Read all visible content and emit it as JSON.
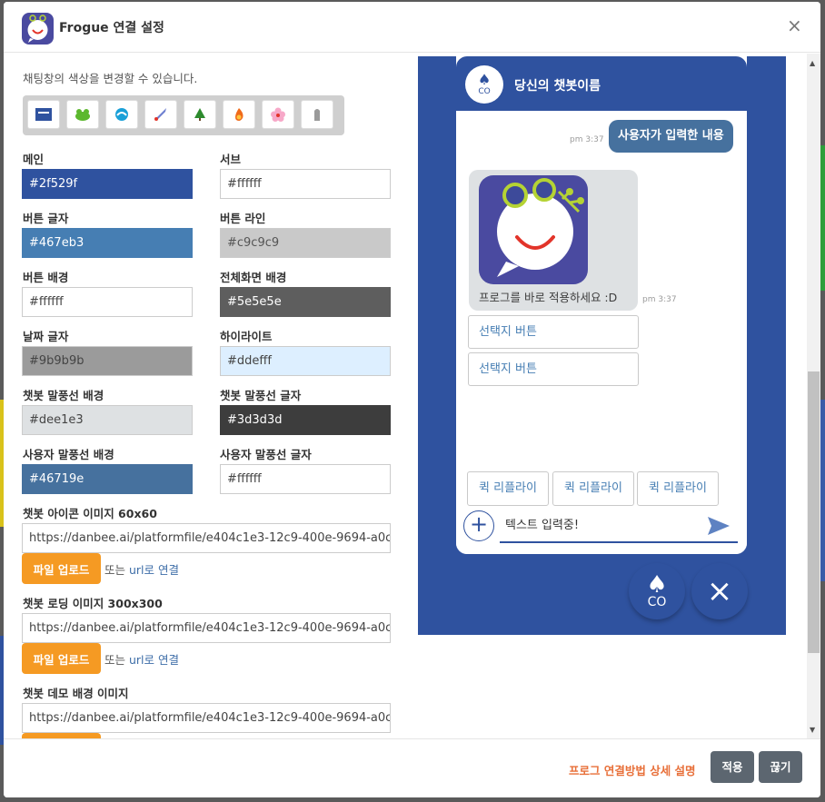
{
  "modal": {
    "title": "Frogue 연결 설정",
    "close_icon": "×"
  },
  "left": {
    "description": "채팅창의 색상을 변경할 수 있습니다.",
    "palette_icons": [
      "back-theme-icon",
      "frog-icon",
      "wave-icon",
      "rocket-icon",
      "tree-icon",
      "fire-icon",
      "flower-icon",
      "stone-icon"
    ],
    "fields": [
      {
        "label": "메인",
        "value": "#2f529f",
        "bg": "#2f529f",
        "fg": "#ffffff"
      },
      {
        "label": "서브",
        "value": "#ffffff",
        "bg": "#ffffff",
        "fg": "#444444"
      },
      {
        "label": "버튼 글자",
        "value": "#467eb3",
        "bg": "#467eb3",
        "fg": "#ffffff"
      },
      {
        "label": "버튼 라인",
        "value": "#c9c9c9",
        "bg": "#c9c9c9",
        "fg": "#555555"
      },
      {
        "label": "버튼 배경",
        "value": "#ffffff",
        "bg": "#ffffff",
        "fg": "#444444"
      },
      {
        "label": "전체화면 배경",
        "value": "#5e5e5e",
        "bg": "#5e5e5e",
        "fg": "#ffffff"
      },
      {
        "label": "날짜 글자",
        "value": "#9b9b9b",
        "bg": "#9b9b9b",
        "fg": "#444444"
      },
      {
        "label": "하이라이트",
        "value": "#ddefff",
        "bg": "#ddefff",
        "fg": "#444444"
      },
      {
        "label": "챗봇 말풍선 배경",
        "value": "#dee1e3",
        "bg": "#dee1e3",
        "fg": "#444444"
      },
      {
        "label": "챗봇 말풍선 글자",
        "value": "#3d3d3d",
        "bg": "#3d3d3d",
        "fg": "#ffffff"
      },
      {
        "label": "사용자 말풍선 배경",
        "value": "#46719e",
        "bg": "#46719e",
        "fg": "#ffffff"
      },
      {
        "label": "사용자 말풍선 글자",
        "value": "#ffffff",
        "bg": "#ffffff",
        "fg": "#444444"
      }
    ],
    "icon_image": {
      "label": "챗봇 아이콘 이미지 60x60",
      "url": "https://danbee.ai/platformfile/e404c1e3-12c9-400e-9694-a0c",
      "upload": "파일 업로드",
      "or": "또는 ",
      "link": "url로 연결"
    },
    "loading_image": {
      "label": "챗봇 로딩 이미지 300x300",
      "url": "https://danbee.ai/platformfile/e404c1e3-12c9-400e-9694-a0c",
      "upload": "파일 업로드",
      "or": "또는 ",
      "link": "url로 연결"
    },
    "demo_bg_image": {
      "label": "챗봇 데모 배경 이미지",
      "url": "https://danbee.ai/platformfile/e404c1e3-12c9-400e-9694-a0c"
    }
  },
  "preview": {
    "bot_name": "당신의 챗봇이름",
    "avatar_text": "CO",
    "user_message": "사용자가 입력한 내용",
    "user_time": "pm 3:37",
    "bot_message": "프로그를 바로 적용하세요 :D",
    "bot_time": "pm 3:37",
    "choices": [
      "선택지 버튼",
      "선택지 버튼"
    ],
    "quick_replies": [
      "퀵 리플라이",
      "퀵 리플라이",
      "퀵 리플라이"
    ],
    "input_placeholder": "텍스트 입력중!",
    "fab_text": "CO"
  },
  "footer": {
    "guide_link": "프로그 연결방법 상세 설명",
    "apply": "적용",
    "close": "끊기"
  }
}
